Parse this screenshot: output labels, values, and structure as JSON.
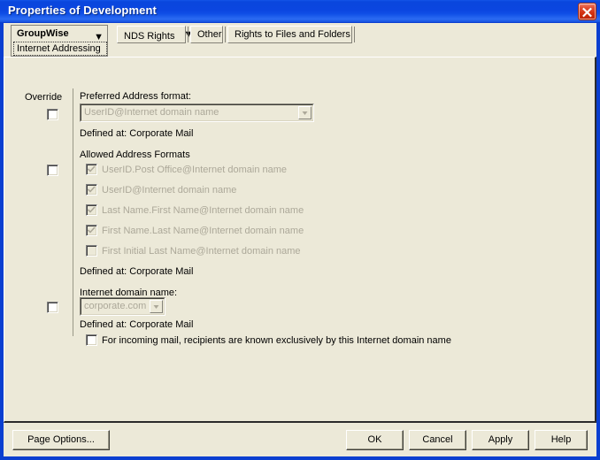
{
  "window": {
    "title": "Properties of Development",
    "close_label": "Close"
  },
  "tabs": {
    "groupwise": {
      "label": "GroupWise",
      "caret": "▼",
      "sub_label": "Internet Addressing"
    },
    "items": [
      {
        "label": "NDS Rights",
        "caret": "▼",
        "has_caret": true
      },
      {
        "label": "Other",
        "caret": "",
        "has_caret": false
      },
      {
        "label": "Rights to Files and Folders",
        "caret": "",
        "has_caret": false
      }
    ]
  },
  "content": {
    "override_column_label": "Override",
    "preferred": {
      "label": "Preferred Address format:",
      "value": "UserID@Internet domain name",
      "defined_at": "Defined at:  Corporate Mail",
      "override_checked": false
    },
    "allowed": {
      "label": "Allowed Address Formats",
      "defined_at": "Defined at:  Corporate Mail",
      "override_checked": false,
      "formats": [
        {
          "label": "UserID.Post Office@Internet domain name",
          "checked": true
        },
        {
          "label": "UserID@Internet domain name",
          "checked": true
        },
        {
          "label": "Last Name.First Name@Internet domain name",
          "checked": true
        },
        {
          "label": "First Name.Last Name@Internet domain name",
          "checked": true
        },
        {
          "label": "First Initial Last Name@Internet domain name",
          "checked": false
        }
      ]
    },
    "domain": {
      "label": "Internet domain name:",
      "value": "corporate.com",
      "defined_at": "Defined at:  Corporate Mail",
      "override_checked": false,
      "exclusive_label": "For incoming mail, recipients are known exclusively by this Internet domain name",
      "exclusive_checked": false
    }
  },
  "buttons": {
    "page_options": "Page Options...",
    "ok": "OK",
    "cancel": "Cancel",
    "apply": "Apply",
    "help": "Help"
  },
  "colors": {
    "titlebar_blue": "#0a46dd",
    "frame_blue": "#0a3fd0",
    "face": "#ece9d8",
    "disabled_text": "#aca899",
    "close_red": "#d23010"
  }
}
